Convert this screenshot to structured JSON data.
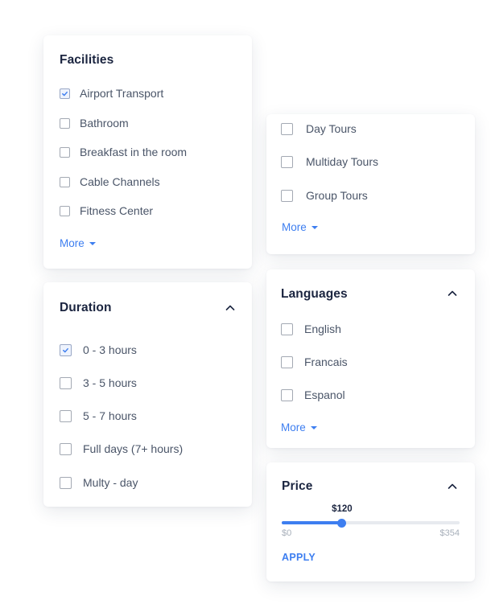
{
  "facilities": {
    "title": "Facilities",
    "options": [
      {
        "label": "Airport Transport",
        "checked": true
      },
      {
        "label": "Bathroom",
        "checked": false
      },
      {
        "label": "Breakfast in the room",
        "checked": false
      },
      {
        "label": "Cable Channels",
        "checked": false
      },
      {
        "label": "Fitness Center",
        "checked": false
      }
    ],
    "more_label": "More"
  },
  "tours": {
    "options": [
      {
        "label": "Day Tours",
        "checked": false
      },
      {
        "label": "Multiday Tours",
        "checked": false
      },
      {
        "label": "Group Tours",
        "checked": false
      }
    ],
    "more_label": "More"
  },
  "duration": {
    "title": "Duration",
    "options": [
      {
        "label": "0 - 3 hours",
        "checked": true
      },
      {
        "label": "3 - 5 hours",
        "checked": false
      },
      {
        "label": "5 - 7 hours",
        "checked": false
      },
      {
        "label": "Full days (7+ hours)",
        "checked": false
      },
      {
        "label": "Multy - day",
        "checked": false
      }
    ]
  },
  "languages": {
    "title": "Languages",
    "options": [
      {
        "label": "English",
        "checked": false
      },
      {
        "label": "Francais",
        "checked": false
      },
      {
        "label": "Espanol",
        "checked": false
      }
    ],
    "more_label": "More"
  },
  "price": {
    "title": "Price",
    "current_label": "$120",
    "min_label": "$0",
    "max_label": "$354",
    "min": 0,
    "max": 354,
    "value": 120,
    "apply_label": "APPLY"
  },
  "colors": {
    "accent": "#3d7ef0",
    "title": "#1b2540",
    "text": "#4a5568",
    "muted": "#a7afba"
  },
  "icons": {
    "checkbox_check": "check-icon",
    "collapse": "chevron-up-icon",
    "more": "caret-down-icon"
  }
}
